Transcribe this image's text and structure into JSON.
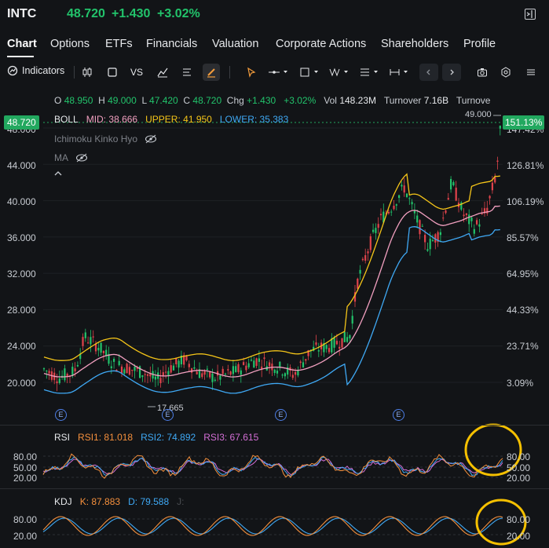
{
  "header": {
    "symbol": "INTC",
    "price": "48.720",
    "change": "+1.430",
    "change_pct": "+3.02%"
  },
  "tabs": [
    "Chart",
    "Options",
    "ETFs",
    "Financials",
    "Valuation",
    "Corporate Actions",
    "Shareholders",
    "Profile"
  ],
  "toolbar": {
    "indicators_label": "Indicators",
    "vs_label": "VS"
  },
  "ohlc": {
    "o_label": "O",
    "o": "48.950",
    "h_label": "H",
    "h": "49.000",
    "l_label": "L",
    "l": "47.420",
    "c_label": "C",
    "c": "48.720",
    "chg_label": "Chg",
    "chg": "+1.430",
    "chg_pct": "+3.02%",
    "vol_label": "Vol",
    "vol": "148.23M",
    "turnover_label": "Turnover",
    "turnover": "7.16B",
    "turnover2_label": "Turnove"
  },
  "boll": {
    "label": "BOLL",
    "mid_label": "MID:",
    "mid": "38.666",
    "upper_label": "UPPER:",
    "upper": "41.950",
    "lower_label": "LOWER:",
    "lower": "35.383"
  },
  "overlays": {
    "ichimoku": "Ichimoku Kinko Hyo",
    "ma": "MA"
  },
  "price_tag": "48.720",
  "pct_tag": "151.13%",
  "high_marker": "49.000",
  "low_marker": "17.665",
  "y_axis_left": [
    "48.000",
    "44.000",
    "40.000",
    "36.000",
    "32.000",
    "28.000",
    "24.000",
    "20.000"
  ],
  "y_axis_right": [
    "147.42%",
    "126.81%",
    "106.19%",
    "85.57%",
    "64.95%",
    "44.33%",
    "23.71%",
    "3.09%"
  ],
  "earnings_marker": "E",
  "rsi": {
    "label": "RSI",
    "rsi1_label": "RSI1:",
    "rsi1": "81.018",
    "rsi2_label": "RSI2:",
    "rsi2": "74.892",
    "rsi3_label": "RSI3:",
    "rsi3": "67.615",
    "levels": [
      "80.00",
      "50.00",
      "20.00"
    ],
    "right_levels": [
      "80.00",
      "50.00",
      "20.00"
    ]
  },
  "kdj": {
    "label": "KDJ",
    "k_label": "K:",
    "k": "87.883",
    "d_label": "D:",
    "d": "79.588",
    "j_label": "J:",
    "levels": [
      "80.00",
      "20.00"
    ],
    "right_levels": [
      "80.00",
      "20.00"
    ]
  },
  "colors": {
    "up": "#22c36b",
    "down": "#e0434b",
    "mid": "#f2a0c0",
    "upper": "#f5c518",
    "lower": "#3fa9f5",
    "rsi1": "#f5903d",
    "rsi2": "#3fa9f5",
    "rsi3": "#d46fd6",
    "highlight": "#f5c000"
  }
}
